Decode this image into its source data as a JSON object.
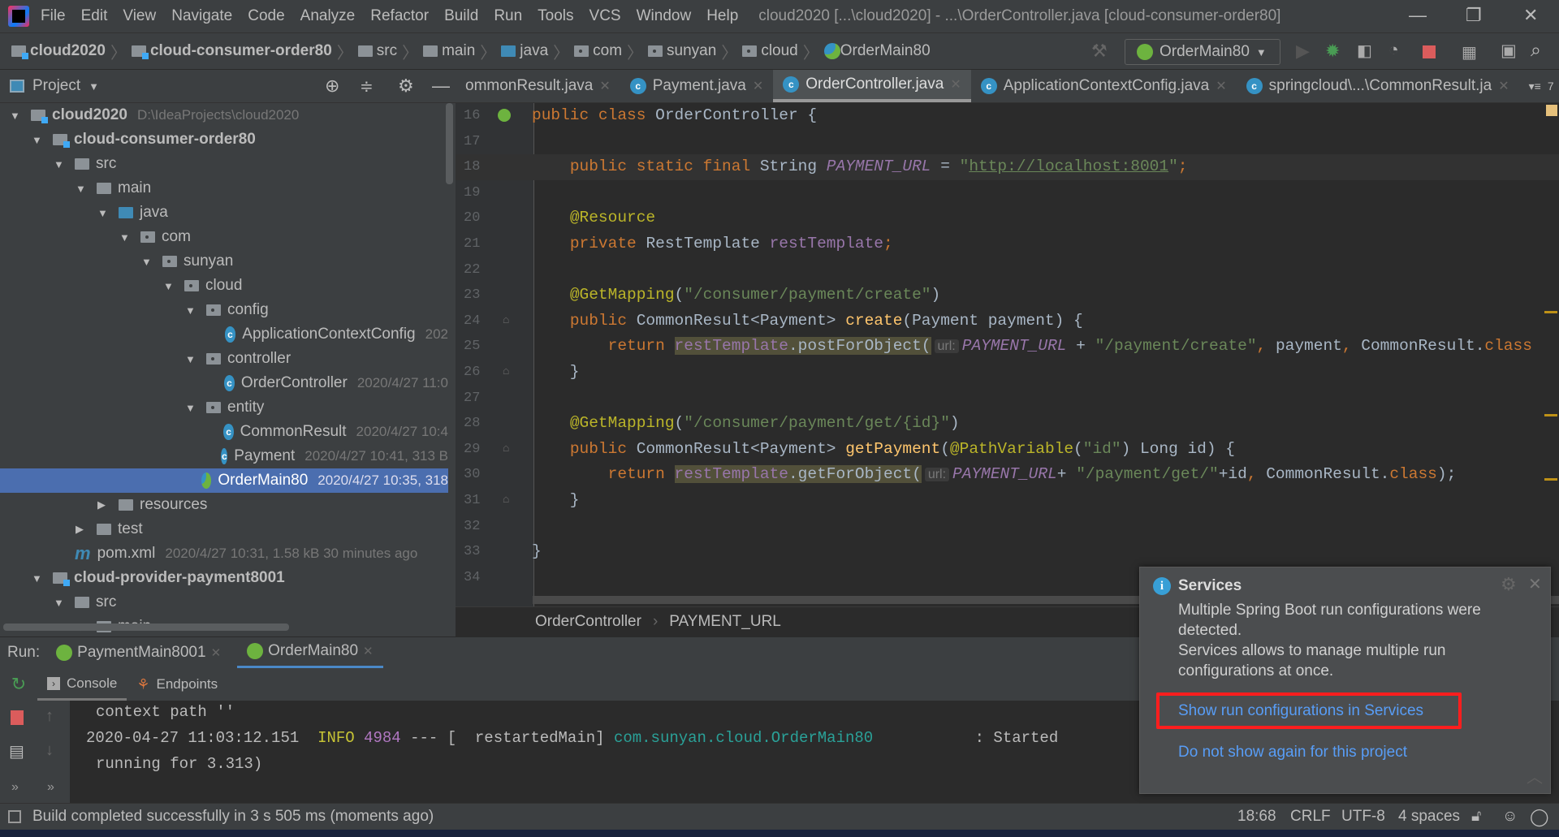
{
  "menu": [
    "File",
    "Edit",
    "View",
    "Navigate",
    "Code",
    "Analyze",
    "Refactor",
    "Build",
    "Run",
    "Tools",
    "VCS",
    "Window",
    "Help"
  ],
  "window_title": "cloud2020 [...\\cloud2020] - ...\\OrderController.java [cloud-consumer-order80]",
  "window_controls": {
    "minimize": "—",
    "restore": "❐",
    "close": "✕"
  },
  "breadcrumb": [
    {
      "label": "cloud2020",
      "icon": "module",
      "bold": true
    },
    {
      "label": "cloud-consumer-order80",
      "icon": "module",
      "bold": true
    },
    {
      "label": "src",
      "icon": "folder"
    },
    {
      "label": "main",
      "icon": "folder"
    },
    {
      "label": "java",
      "icon": "source-folder"
    },
    {
      "label": "com",
      "icon": "package"
    },
    {
      "label": "sunyan",
      "icon": "package"
    },
    {
      "label": "cloud",
      "icon": "package"
    },
    {
      "label": "OrderMain80",
      "icon": "spring-boot-class"
    }
  ],
  "run_config": {
    "selected": "OrderMain80"
  },
  "project_panel": {
    "title": "Project"
  },
  "editor_tabs": [
    {
      "label": "ommonResult.java",
      "active": false
    },
    {
      "label": "Payment.java",
      "active": false
    },
    {
      "label": "OrderController.java",
      "active": true
    },
    {
      "label": "ApplicationContextConfig.java",
      "active": false
    },
    {
      "label": "springcloud\\...\\CommonResult.ja",
      "active": false
    }
  ],
  "tabs_overflow": "7",
  "tree": [
    {
      "level": 0,
      "label": "cloud2020",
      "meta": "D:\\IdeaProjects\\cloud2020",
      "icon": "module",
      "expanded": true,
      "bold": true
    },
    {
      "level": 1,
      "label": "cloud-consumer-order80",
      "icon": "module",
      "expanded": true,
      "bold": true
    },
    {
      "level": 2,
      "label": "src",
      "icon": "folder",
      "expanded": true
    },
    {
      "level": 3,
      "label": "main",
      "icon": "folder",
      "expanded": true
    },
    {
      "level": 4,
      "label": "java",
      "icon": "source-folder",
      "expanded": true
    },
    {
      "level": 5,
      "label": "com",
      "icon": "package",
      "expanded": true
    },
    {
      "level": 6,
      "label": "sunyan",
      "icon": "package",
      "expanded": true
    },
    {
      "level": 7,
      "label": "cloud",
      "icon": "package",
      "expanded": true
    },
    {
      "level": 8,
      "label": "config",
      "icon": "package",
      "expanded": true
    },
    {
      "level": 9,
      "label": "ApplicationContextConfig",
      "meta": "202",
      "icon": "class"
    },
    {
      "level": 8,
      "label": "controller",
      "icon": "package",
      "expanded": true
    },
    {
      "level": 9,
      "label": "OrderController",
      "meta": "2020/4/27 11:0",
      "icon": "class"
    },
    {
      "level": 8,
      "label": "entity",
      "icon": "package",
      "expanded": true
    },
    {
      "level": 9,
      "label": "CommonResult",
      "meta": "2020/4/27 10:4",
      "icon": "class"
    },
    {
      "level": 9,
      "label": "Payment",
      "meta": "2020/4/27 10:41, 313 B",
      "icon": "class"
    },
    {
      "level": 8,
      "label": "OrderMain80",
      "meta": "2020/4/27 10:35, 318",
      "icon": "spring-boot-class",
      "selected": true
    },
    {
      "level": 4,
      "label": "resources",
      "icon": "resources-folder",
      "expanded": false
    },
    {
      "level": 3,
      "label": "test",
      "icon": "folder",
      "expanded": false
    },
    {
      "level": 2,
      "label": "pom.xml",
      "meta": "2020/4/27 10:31, 1.58 kB 30 minutes ago",
      "icon": "maven"
    },
    {
      "level": 1,
      "label": "cloud-provider-payment8001",
      "icon": "module",
      "expanded": true,
      "bold": true
    },
    {
      "level": 2,
      "label": "src",
      "icon": "folder",
      "expanded": true
    },
    {
      "level": 3,
      "label": "main",
      "icon": "folder",
      "expanded": true
    }
  ],
  "code": [
    {
      "n": "16",
      "t": [
        [
          "k",
          "public class "
        ],
        [
          "",
          "OrderController {"
        ]
      ]
    },
    {
      "n": "17",
      "t": []
    },
    {
      "n": "18",
      "cur": true,
      "t": [
        [
          "",
          "    "
        ],
        [
          "k",
          "public static final "
        ],
        [
          "",
          "String "
        ],
        [
          "f",
          "PAYMENT_URL"
        ],
        [
          "",
          " = "
        ],
        [
          "s",
          "\""
        ],
        [
          "u",
          "http://localhost:8001"
        ],
        [
          "s",
          "\""
        ],
        [
          "k",
          ";"
        ]
      ]
    },
    {
      "n": "19",
      "t": []
    },
    {
      "n": "20",
      "t": [
        [
          "",
          "    "
        ],
        [
          "an",
          "@Resource"
        ]
      ]
    },
    {
      "n": "21",
      "t": [
        [
          "",
          "    "
        ],
        [
          "k",
          "private "
        ],
        [
          "",
          "RestTemplate "
        ],
        [
          "fi",
          "restTemplate"
        ],
        [
          "k",
          ";"
        ]
      ]
    },
    {
      "n": "22",
      "t": []
    },
    {
      "n": "23",
      "t": [
        [
          "",
          "    "
        ],
        [
          "an",
          "@GetMapping"
        ],
        [
          "",
          "("
        ],
        [
          "s",
          "\"/consumer/payment/create\""
        ],
        [
          "",
          ")"
        ]
      ]
    },
    {
      "n": "24",
      "t": [
        [
          "",
          "    "
        ],
        [
          "k",
          "public "
        ],
        [
          "",
          "CommonResult<Payment> "
        ],
        [
          "m",
          "create"
        ],
        [
          "",
          "(Payment payment) {"
        ]
      ]
    },
    {
      "n": "25",
      "t": [
        [
          "",
          "        "
        ],
        [
          "k",
          "return "
        ],
        [
          "hlfi",
          "restTemplate"
        ],
        [
          "hl",
          ".postForObject("
        ],
        [
          "hint",
          "url:"
        ],
        [
          "f",
          "PAYMENT_URL"
        ],
        [
          "",
          " + "
        ],
        [
          "s",
          "\"/payment/create\""
        ],
        [
          "k",
          ", "
        ],
        [
          "",
          "payment"
        ],
        [
          "k",
          ", "
        ],
        [
          "",
          "CommonResult."
        ],
        [
          "k",
          "class"
        ]
      ]
    },
    {
      "n": "26",
      "t": [
        [
          "",
          "    }"
        ]
      ]
    },
    {
      "n": "27",
      "t": []
    },
    {
      "n": "28",
      "t": [
        [
          "",
          "    "
        ],
        [
          "an",
          "@GetMapping"
        ],
        [
          "",
          "("
        ],
        [
          "s",
          "\"/consumer/payment/get/{id}\""
        ],
        [
          "",
          ")"
        ]
      ]
    },
    {
      "n": "29",
      "t": [
        [
          "",
          "    "
        ],
        [
          "k",
          "public "
        ],
        [
          "",
          "CommonResult<Payment> "
        ],
        [
          "m",
          "getPayment"
        ],
        [
          "",
          "("
        ],
        [
          "an",
          "@PathVariable"
        ],
        [
          "",
          "("
        ],
        [
          "s",
          "\"id\""
        ],
        [
          "",
          ") Long id) {"
        ]
      ]
    },
    {
      "n": "30",
      "t": [
        [
          "",
          "        "
        ],
        [
          "k",
          "return "
        ],
        [
          "hlfi",
          "restTemplate"
        ],
        [
          "hl",
          ".getForObject("
        ],
        [
          "hint",
          "url:"
        ],
        [
          "f",
          "PAYMENT_URL"
        ],
        [
          "",
          "+ "
        ],
        [
          "s",
          "\"/payment/get/\""
        ],
        [
          "",
          "+id"
        ],
        [
          "k",
          ", "
        ],
        [
          "",
          "CommonResult."
        ],
        [
          "k",
          "class"
        ],
        [
          "",
          "); "
        ]
      ]
    },
    {
      "n": "31",
      "t": [
        [
          "",
          "    }"
        ]
      ]
    },
    {
      "n": "32",
      "t": []
    },
    {
      "n": "33",
      "t": [
        [
          "",
          "}"
        ]
      ]
    },
    {
      "n": "34",
      "t": []
    }
  ],
  "editor_breadcrumb": [
    "OrderController",
    "PAYMENT_URL"
  ],
  "run": {
    "label": "Run:",
    "tabs": [
      {
        "label": "PaymentMain8001",
        "active": false
      },
      {
        "label": "OrderMain80",
        "active": true
      }
    ],
    "console_tabs": [
      {
        "label": "Console",
        "active": true
      },
      {
        "label": "Endpoints",
        "active": false
      }
    ],
    "console": {
      "line1": "context path ''",
      "line2_time": "2020-04-27 11:03:12.151",
      "line2_level": "INFO",
      "line2_pid": "4984",
      "line2_thread": " --- [  restartedMain] ",
      "line2_class": "com.sunyan.cloud.OrderMain80",
      "line2_msg": "           : Started",
      "line3": "running for 3.313)"
    }
  },
  "status": {
    "message": "Build completed successfully in 3 s 505 ms (moments ago)",
    "position": "18:68",
    "line_sep": "CRLF",
    "encoding": "UTF-8",
    "indent": "4 spaces"
  },
  "notification": {
    "title": "Services",
    "body_1": "Multiple Spring Boot run configurations were detected.",
    "body_2": "Services allows to manage multiple run configurations at once.",
    "action_primary": "Show run configurations in Services",
    "action_secondary": "Do not show again for this project",
    "highlight_color": "#ff1e1e"
  },
  "colors": {
    "accent": "#4b6eaf",
    "link": "#589df6",
    "keyword": "#cc7832",
    "string": "#6a8759"
  }
}
